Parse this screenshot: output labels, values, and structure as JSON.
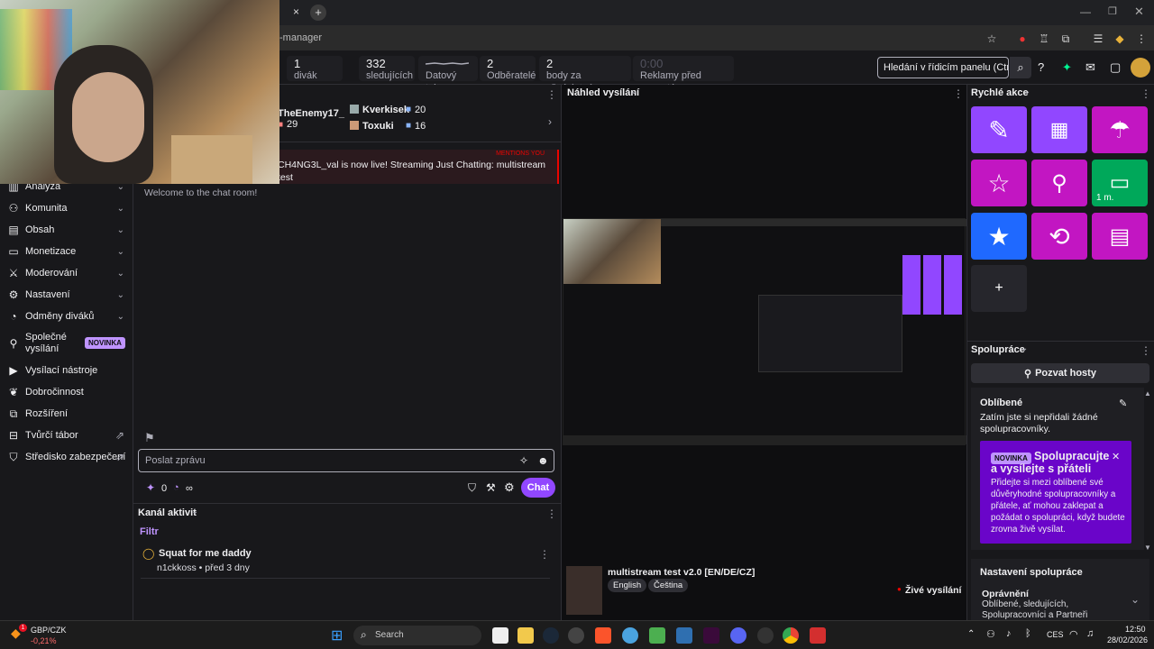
{
  "browser": {
    "tab_close": "×",
    "tab_new": "+",
    "url_fragment": "-manager"
  },
  "stats": [
    {
      "value": "1",
      "label": "divák"
    },
    {
      "value": "332",
      "label": "sledujících"
    },
    {
      "value": "",
      "label": "Datový tok"
    },
    {
      "value": "2",
      "label": "Odběratelé"
    },
    {
      "value": "2",
      "label": "body za předplatné"
    },
    {
      "value": "0:00",
      "label": "Reklamy před zapnuté"
    }
  ],
  "search": {
    "placeholder": "Hledání v řídicím panelu (Ctrl +"
  },
  "sidebar": {
    "items": [
      {
        "label": "Analýza"
      },
      {
        "label": "Komunita"
      },
      {
        "label": "Obsah"
      },
      {
        "label": "Monetizace"
      },
      {
        "label": "Moderování"
      },
      {
        "label": "Nastavení"
      },
      {
        "label": "Odměny diváků"
      },
      {
        "label": "Společné vysílání",
        "badge": "NOVINKA"
      },
      {
        "label": "Vysílací nástroje"
      },
      {
        "label": "Dobročinnost"
      },
      {
        "label": "Rozšíření"
      },
      {
        "label": "Tvůrčí tábor"
      },
      {
        "label": "Středisko zabezpečení"
      }
    ]
  },
  "leaderboard": {
    "first": {
      "name": "TheEnemy17_",
      "value": "29"
    },
    "second": {
      "name": "Kverkisek",
      "value": "20"
    },
    "third": {
      "name": "Toxuki",
      "value": "16"
    }
  },
  "mention": {
    "tag": "MENTIONS YOU",
    "text": "CH4NG3L_val is now live! Streaming Just Chatting: multistream test"
  },
  "chat": {
    "welcome": "Welcome to the chat room!",
    "input_placeholder": "Poslat zprávu",
    "points": "0",
    "infinity": "∞",
    "chat_button": "Chat"
  },
  "activity": {
    "title": "Kanál aktivit",
    "filter": "Filtr",
    "item_title": "Squat for me daddy",
    "item_meta": "n1ckkoss • před 3 dny"
  },
  "preview": {
    "title": "Náhled vysílání",
    "stream_title": "multistream test v2.0 [EN/DE/CZ]",
    "tags": [
      "English",
      "Čeština"
    ],
    "live": "Živé vysílání"
  },
  "quick_actions": {
    "title": "Rychlé akce",
    "items": [
      {
        "icon": "pencil-icon",
        "color": "#9147ff",
        "glyph": "✎"
      },
      {
        "icon": "clapper-icon",
        "color": "#9147ff",
        "glyph": "▦"
      },
      {
        "icon": "parachute-icon",
        "color": "#c216c2",
        "glyph": "⛱"
      },
      {
        "icon": "star-outline-icon",
        "color": "#c216c2",
        "glyph": "☆"
      },
      {
        "icon": "add-user-icon",
        "color": "#c216c2",
        "glyph": "👤"
      },
      {
        "icon": "cash-icon",
        "color": "#00a85a",
        "glyph": "▭",
        "label": "1 m."
      },
      {
        "icon": "star-filled-icon",
        "color": "#1f69ff",
        "glyph": "★"
      },
      {
        "icon": "restart-icon",
        "color": "#c216c2",
        "glyph": "⟲"
      },
      {
        "icon": "layout-icon",
        "color": "#c216c2",
        "glyph": "▤"
      }
    ],
    "add": "+"
  },
  "collab": {
    "title": "Spolupráce",
    "invite": "Pozvat hosty",
    "fav_title": "Oblíbené",
    "fav_text": "Zatím jste si nepřidali žádné spolupracovníky.",
    "promo_badge": "NOVINKA",
    "promo_title": "Spolupracujte a vysílejte s přáteli",
    "promo_text": "Přidejte si mezi oblíbené své důvěryhodné spolupracovníky a přátele, ať mohou zaklepat a požádat o spolupráci, když budete zrovna živě vysílat.",
    "settings_title": "Nastavení spolupráce",
    "perm_title": "Oprávnění",
    "perm_text": "Oblíbené, sledujících, Spolupracovníci a Partneři"
  },
  "taskbar": {
    "ticker_name": "GBP/CZK",
    "ticker_change": "-0,21%",
    "ticker_badge": "1",
    "search": "Search",
    "lang": "CES",
    "time": "12:50",
    "date": "28/02/2026"
  }
}
